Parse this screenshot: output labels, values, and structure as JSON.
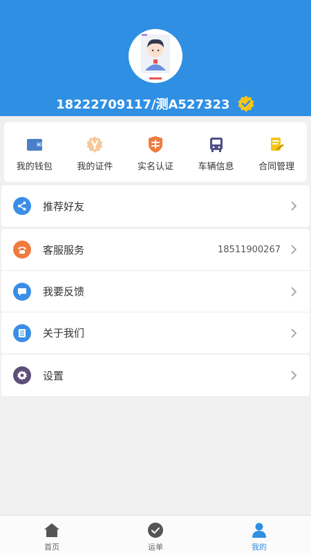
{
  "header": {
    "user_info": "18222709117/测A527323",
    "verified_icon": "verified-badge-icon",
    "bg_color": "#2f8fe3"
  },
  "quick_actions": [
    {
      "label": "我的钱包",
      "icon": "wallet-icon"
    },
    {
      "label": "我的证件",
      "icon": "certificate-icon"
    },
    {
      "label": "实名认证",
      "icon": "real-name-shield-icon"
    },
    {
      "label": "车辆信息",
      "icon": "bus-icon"
    },
    {
      "label": "合同管理",
      "icon": "contract-icon"
    }
  ],
  "menu": {
    "recommend": {
      "label": "推荐好友",
      "icon": "share-icon",
      "color": "#3a8ee6"
    },
    "service": {
      "label": "客服服务",
      "value": "18511900267",
      "icon": "phone-icon",
      "color": "#f07b3f"
    },
    "feedback": {
      "label": "我要反馈",
      "icon": "chat-icon",
      "color": "#3a8ee6"
    },
    "about": {
      "label": "关于我们",
      "icon": "list-icon",
      "color": "#3a8ee6"
    },
    "settings": {
      "label": "设置",
      "icon": "gear-icon",
      "color": "#5d4e7b"
    }
  },
  "tabbar": [
    {
      "label": "首页",
      "icon": "home-icon",
      "active": false
    },
    {
      "label": "运单",
      "icon": "check-circle-icon",
      "active": false
    },
    {
      "label": "我的",
      "icon": "person-icon",
      "active": true
    }
  ]
}
